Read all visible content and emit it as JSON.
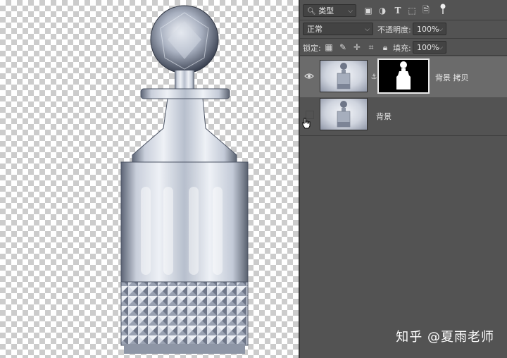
{
  "panel": {
    "filter": {
      "label": "类型"
    },
    "blend": {
      "mode": "正常",
      "opacity_label": "不透明度:",
      "opacity_value": "100%"
    },
    "lock": {
      "label": "锁定:",
      "fill_label": "填充:",
      "fill_value": "100%"
    },
    "layers": [
      {
        "name": "背景 拷贝",
        "visible": true,
        "has_mask": true,
        "selected": true
      },
      {
        "name": "背景",
        "visible": false,
        "has_mask": false,
        "selected": false
      }
    ]
  },
  "watermark": "知乎 @夏雨老师",
  "colors": {
    "panel_bg": "#535353",
    "selected_layer": "#6b6b6b",
    "field_bg": "#434343"
  }
}
